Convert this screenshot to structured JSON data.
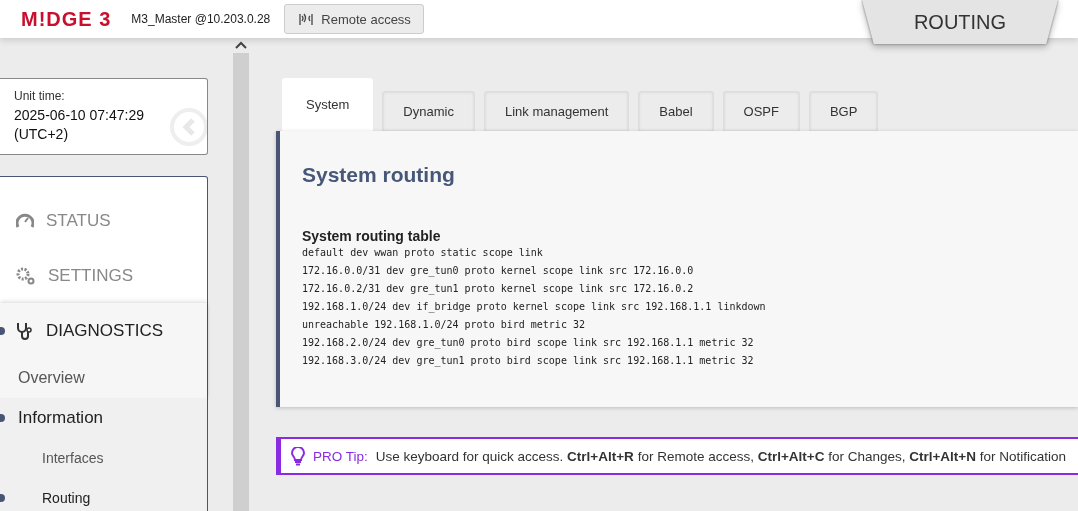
{
  "header": {
    "logo": "M!DGE 3",
    "device": "M3_Master @10.203.0.28",
    "remote_button": "Remote access",
    "section_tab": "ROUTING"
  },
  "unit_time": {
    "label": "Unit time:",
    "value": "2025-06-10 07:47:29",
    "zone": "(UTC+2)"
  },
  "sidebar": {
    "items": [
      {
        "label": "STATUS",
        "selected": false
      },
      {
        "label": "SETTINGS",
        "selected": false
      },
      {
        "label": "DIAGNOSTICS",
        "selected": true,
        "children": [
          {
            "label": "Overview",
            "selected": false
          },
          {
            "label": "Information",
            "selected": true,
            "children": [
              {
                "label": "Interfaces",
                "selected": false
              },
              {
                "label": "Routing",
                "selected": true
              }
            ]
          }
        ]
      }
    ]
  },
  "tabs": [
    {
      "label": "System",
      "selected": true
    },
    {
      "label": "Dynamic",
      "selected": false
    },
    {
      "label": "Link management",
      "selected": false
    },
    {
      "label": "Babel",
      "selected": false
    },
    {
      "label": "OSPF",
      "selected": false
    },
    {
      "label": "BGP",
      "selected": false
    }
  ],
  "panel": {
    "title": "System routing",
    "table_title": "System routing table",
    "lines": [
      "default dev wwan proto static scope link",
      "172.16.0.0/31 dev gre_tun0 proto kernel scope link src 172.16.0.0",
      "172.16.0.2/31 dev gre_tun1 proto kernel scope link src 172.16.0.2",
      "192.168.1.0/24 dev if_bridge proto kernel scope link src 192.168.1.1 linkdown",
      "unreachable 192.168.1.0/24 proto bird metric 32",
      "192.168.2.0/24 dev gre_tun0 proto bird scope link src 192.168.1.1 metric 32",
      "192.168.3.0/24 dev gre_tun1 proto bird scope link src 192.168.1.1 metric 32"
    ]
  },
  "tip": {
    "label": "PRO Tip:",
    "text": "Use keyboard for quick access. **Ctrl+Alt+R** for Remote access, **Ctrl+Alt+C** for Changes, **Ctrl+Alt+N** for Notification"
  }
}
